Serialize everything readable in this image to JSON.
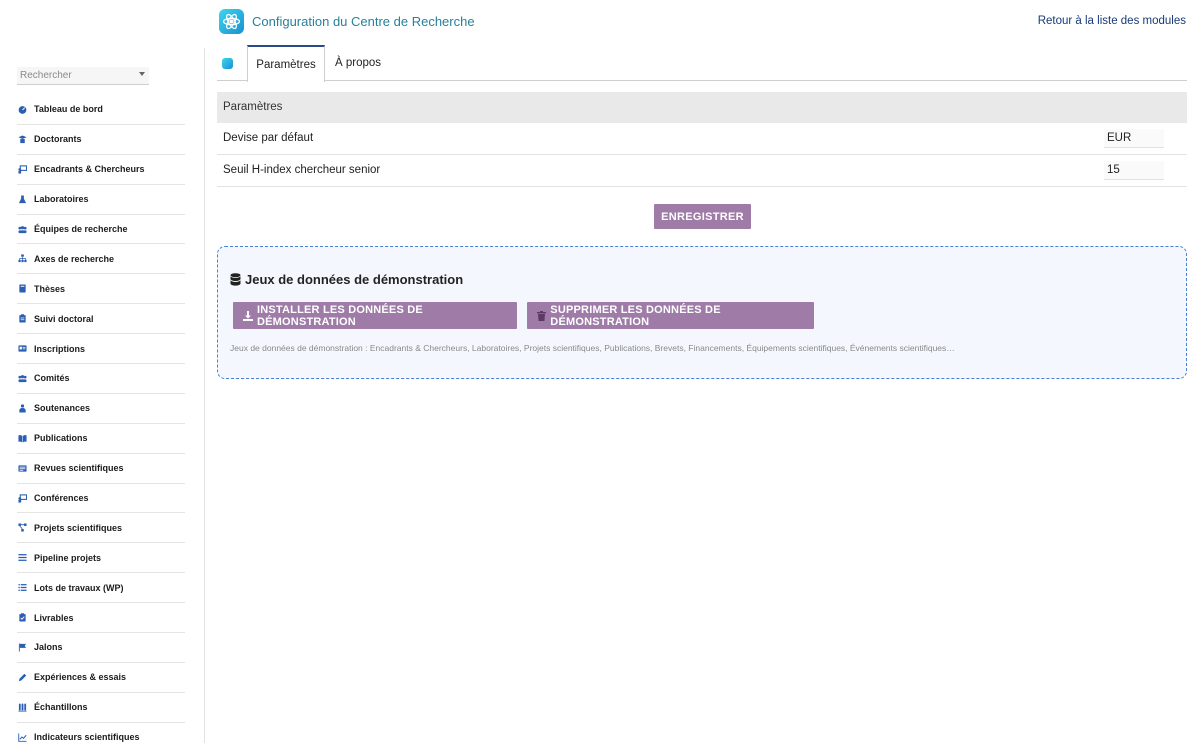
{
  "header": {
    "module_title": "Configuration du Centre de Recherche",
    "back_link": "Retour à la liste des modules"
  },
  "sidebar": {
    "search_placeholder": "Rechercher",
    "items": [
      {
        "label": "Tableau de bord",
        "icon": "gauge-icon"
      },
      {
        "label": "Doctorants",
        "icon": "graduate-icon"
      },
      {
        "label": "Encadrants & Chercheurs",
        "icon": "teacher-icon"
      },
      {
        "label": "Laboratoires",
        "icon": "flask-icon"
      },
      {
        "label": "Équipes de recherche",
        "icon": "users-icon"
      },
      {
        "label": "Axes de recherche",
        "icon": "sitemap-icon"
      },
      {
        "label": "Thèses",
        "icon": "book-icon"
      },
      {
        "label": "Suivi doctoral",
        "icon": "clipboard-icon"
      },
      {
        "label": "Inscriptions",
        "icon": "id-card-icon"
      },
      {
        "label": "Comités",
        "icon": "users-icon"
      },
      {
        "label": "Soutenances",
        "icon": "presenter-icon"
      },
      {
        "label": "Publications",
        "icon": "open-book-icon"
      },
      {
        "label": "Revues scientifiques",
        "icon": "newspaper-icon"
      },
      {
        "label": "Conférences",
        "icon": "teacher-icon"
      },
      {
        "label": "Projets scientifiques",
        "icon": "project-diagram-icon"
      },
      {
        "label": "Pipeline projets",
        "icon": "bars-icon"
      },
      {
        "label": "Lots de travaux (WP)",
        "icon": "list-icon"
      },
      {
        "label": "Livrables",
        "icon": "clipboard-check-icon"
      },
      {
        "label": "Jalons",
        "icon": "flag-icon"
      },
      {
        "label": "Expériences & essais",
        "icon": "pen-icon"
      },
      {
        "label": "Échantillons",
        "icon": "vials-icon"
      },
      {
        "label": "Indicateurs scientifiques",
        "icon": "chart-line-icon"
      }
    ]
  },
  "tabs": [
    {
      "label": "Paramètres",
      "active": true
    },
    {
      "label": "À propos",
      "active": false
    }
  ],
  "params": {
    "section_title": "Paramètres",
    "rows": [
      {
        "label": "Devise par défaut",
        "value": "EUR"
      },
      {
        "label": "Seuil H-index chercheur senior",
        "value": "15"
      }
    ],
    "save_label": "ENREGISTRER"
  },
  "demo": {
    "title": "Jeux de données de démonstration",
    "install_label": "INSTALLER LES DONNÉES DE DÉMONSTRATION",
    "delete_label": "SUPPRIMER LES DONNÉES DE DÉMONSTRATION",
    "description": "Jeux de données de démonstration : Encadrants & Chercheurs, Laboratoires, Projets scientifiques, Publications, Brevets, Financements, Équipements scientifiques, Événements scientifiques…"
  },
  "colors": {
    "accent_button": "#9f7ba8",
    "title_teal": "#26829a",
    "link_navy": "#173a7a",
    "icon_blue": "#2b5fb3",
    "demo_border": "#4a7ed4"
  }
}
